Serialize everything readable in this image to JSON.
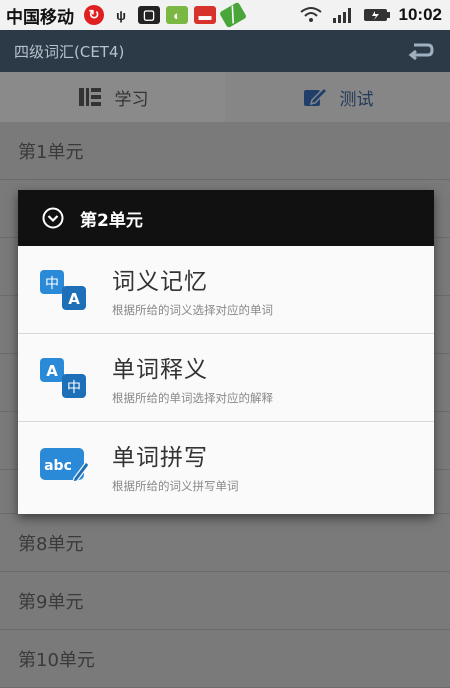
{
  "statusbar": {
    "carrier": "中国移动",
    "time": "10:02",
    "icons": [
      "data-sync-icon",
      "usb-icon",
      "sim-icon",
      "app-icon",
      "battery-saver-icon",
      "app-icon",
      "wifi-icon",
      "signal-icon",
      "battery-icon"
    ]
  },
  "appbar": {
    "title": "四级词汇(CET4)"
  },
  "tabs": [
    {
      "label": "学习",
      "icon": "study-icon"
    },
    {
      "label": "测试",
      "icon": "edit-icon"
    }
  ],
  "list": {
    "items": [
      "第1单元",
      "",
      "",
      "",
      "",
      "",
      "",
      "第8单元",
      "第9单元",
      "第10单元"
    ]
  },
  "dialog": {
    "title": "第2单元",
    "options": [
      {
        "title": "词义记忆",
        "subtitle": "根据所给的词义选择对应的单词",
        "icon": "zh-to-en-icon"
      },
      {
        "title": "单词释义",
        "subtitle": "根据所给的单词选择对应的解释",
        "icon": "en-to-zh-icon"
      },
      {
        "title": "单词拼写",
        "subtitle": "根据所给的词义拼写单词",
        "icon": "abc-spell-icon"
      }
    ]
  }
}
